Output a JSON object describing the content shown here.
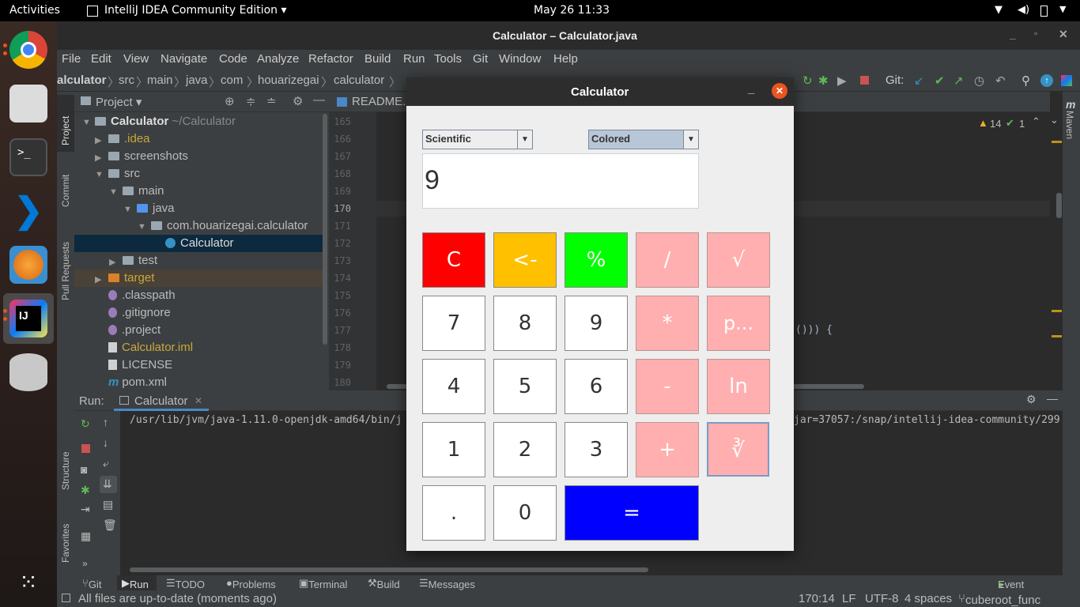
{
  "topbar": {
    "activities": "Activities",
    "app": "IntelliJ IDEA Community Edition ▾",
    "clock": "May 26  11:33"
  },
  "window": {
    "title": "Calculator – Calculator.java"
  },
  "menu": [
    "File",
    "Edit",
    "View",
    "Navigate",
    "Code",
    "Analyze",
    "Refactor",
    "Build",
    "Run",
    "Tools",
    "Git",
    "Window",
    "Help"
  ],
  "breadcrumb": [
    "alculator",
    "src",
    "main",
    "java",
    "com",
    "houarizegai",
    "calculator"
  ],
  "git_label": "Git:",
  "project": {
    "header": "Project ▾",
    "root": "Calculator",
    "root_path": "~/Calculator",
    "items": [
      ".idea",
      "screenshots",
      "src",
      "main",
      "java",
      "com.houarizegai.calculator",
      "Calculator",
      "test",
      "target",
      ".classpath",
      ".gitignore",
      ".project",
      "Calculator.iml",
      "LICENSE",
      "pom.xml"
    ]
  },
  "editor": {
    "tab": "README.m",
    "lines": [
      "165",
      "166",
      "167",
      "168",
      "169",
      "170",
      "171",
      "172",
      "173",
      "174",
      "175",
      "176",
      "177",
      "178",
      "179",
      "180"
    ],
    "code_fragment": "())) {",
    "warnings": "14",
    "checks": "1"
  },
  "left_tools": {
    "project": "Project",
    "commit": "Commit",
    "pull": "Pull Requests",
    "structure": "Structure",
    "favorites": "Favorites"
  },
  "right_tools": {
    "maven": "Maven"
  },
  "run": {
    "label": "Run:",
    "tab": "Calculator",
    "cmd": "/usr/lib/jvm/java-1.11.0-openjdk-amd64/bin/j",
    "cmd_right": "jar=37057:/snap/intellij-idea-community/299"
  },
  "bottom_tabs": [
    "Git",
    "Run",
    "TODO",
    "Problems",
    "Terminal",
    "Build",
    "Messages"
  ],
  "event_log": "Event Log",
  "status": {
    "message": "All files are up-to-date (moments ago)",
    "position": "170:14",
    "line_sep": "LF",
    "encoding": "UTF-8",
    "indent": "4 spaces",
    "branch": "cuberoot_func"
  },
  "calculator": {
    "title": "Calculator",
    "mode": "Scientific",
    "theme": "Colored",
    "display": "9",
    "buttons": {
      "c": "C",
      "back": "<-",
      "percent": "%",
      "div": "/",
      "sqrt": "√",
      "n7": "7",
      "n8": "8",
      "n9": "9",
      "mul": "*",
      "pow": "p...",
      "n4": "4",
      "n5": "5",
      "n6": "6",
      "sub": "-",
      "ln": "ln",
      "n1": "1",
      "n2": "2",
      "n3": "3",
      "add": "+",
      "cbrt": "∛",
      "dot": ".",
      "n0": "0",
      "eq": "="
    },
    "colors": {
      "clear": "#ff0000",
      "back": "#ffc000",
      "percent": "#00ff00",
      "operator": "#ffafaf",
      "equals": "#0000ff"
    }
  }
}
